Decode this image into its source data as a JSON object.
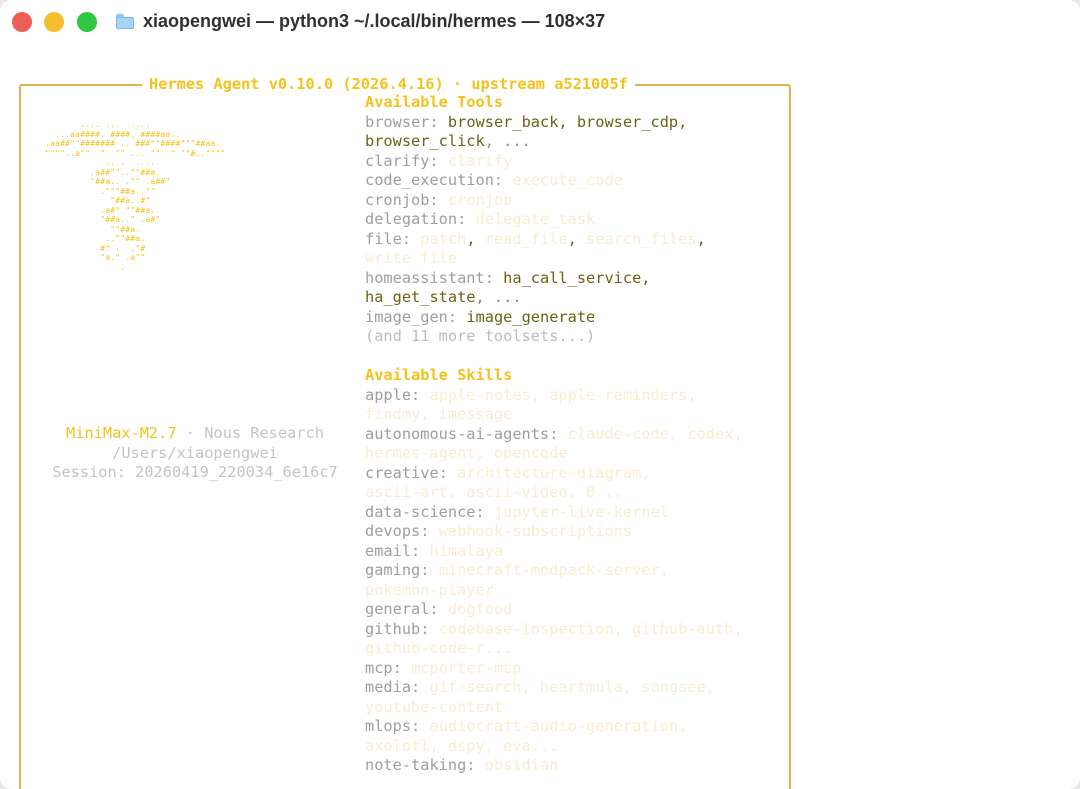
{
  "window": {
    "title": "xiaopengwei — python3 ~/.local/bin/hermes — 108×37",
    "controls": [
      "close",
      "minimize",
      "zoom"
    ]
  },
  "banner": {
    "title": "Hermes Agent v0.10.0 (2026.4.16) · upstream a521005f"
  },
  "logo_art": "        .... ...  ....\n    ..aa####. ####. ####aa..\n .aa##\"\"####### .. ###\"\"####\"\"\"##aa.\n \"\"\"\"..a\"\"  \"  \"\" ... \"\"  \" \"\"#..\"\"\"\"\n             ....  ....\n          .a##\"\"..\"\"##a.\n          \"##a.. .\"\" .a##\"\n            .\"\"\"##a..\"\"\n              \"##a..#\"\n            .a#\" \"\"##a.\n            \"##a..\" .a#\"\n              \"\"##a.\n             ..\"\"##a.\n            #\" .  .\"#\n            \"a.\" .a\"\"\n                .",
  "info": {
    "model": "MiniMax-M2.7",
    "separator": " · ",
    "provider": "Nous Research",
    "cwd": "/Users/xiaopengwei",
    "session": "Session: 20260419_220034_6e16c7"
  },
  "tools": {
    "heading": "Available Tools",
    "browser_label": "browser:",
    "browser_items_1": "browser_back, browser_cdp,",
    "browser_items_2": "browser_click",
    "browser_more": ", ...",
    "clarify_label": "clarify:",
    "clarify_items": "clarify",
    "code_label": "code_execution:",
    "code_items": "execute_code",
    "cron_label": "cronjob:",
    "cron_items": "cronjob",
    "delegation_label": "delegation:",
    "delegation_items": "delegate_task",
    "file_label": "file:",
    "file_items_1": "patch",
    "file_sep_1": ", ",
    "file_items_2": "read_file",
    "file_sep_2": ", ",
    "file_items_3": "search_files",
    "file_sep_3": ",",
    "file_items_4": "write_file",
    "ha_label": "homeassistant:",
    "ha_items_1": "ha_call_service,",
    "ha_items_2": "ha_get_state",
    "ha_more": ", ...",
    "image_label": "image_gen:",
    "image_items": "image_generate",
    "more": "(and 11 more toolsets...)"
  },
  "skills": {
    "heading": "Available Skills",
    "apple_label": "apple:",
    "apple_items_1": "apple-notes, apple-reminders,",
    "apple_items_2": "findmy, imessage",
    "autonomous_label": "autonomous-ai-agents:",
    "autonomous_items_1": "claude-code, codex,",
    "autonomous_items_2": "hermes-agent, opencode",
    "creative_label": "creative:",
    "creative_items_1": "architecture-diagram,",
    "creative_items_2": "ascii-art, ascii-video, 0...",
    "datascience_label": "data-science:",
    "datascience_items": "jupyter-live-kernel",
    "devops_label": "devops:",
    "devops_items": "webhook-subscriptions",
    "email_label": "email:",
    "email_items": "himalaya",
    "gaming_label": "gaming:",
    "gaming_items_1": "minecraft-modpack-server,",
    "gaming_items_2": "pokemon-player",
    "general_label": "general:",
    "general_items": "dogfood",
    "github_label": "github:",
    "github_items_1": "codebase-inspection, github-auth,",
    "github_items_2": "github-code-r...",
    "mcp_label": "mcp:",
    "mcp_items": "mcporter-mcp",
    "media_label": "media:",
    "media_items_1": "gif-search, heartmula, songsee,",
    "media_items_2": "youtube-content",
    "mlops_label": "mlops:",
    "mlops_items_1": "audiocraft-audio-generation,",
    "mlops_items_2": "axolotl, dspy, eva...",
    "notetaking_label": "note-taking:",
    "notetaking_items": "obsidian"
  },
  "colors": {
    "accent_gold": "#f3c31c",
    "border": "#e3b24f",
    "tool_name": "#6d6212",
    "category": "#9e9e9e",
    "faint": "#f8edd0",
    "close": "#ec5f57",
    "minimize": "#f6be2f",
    "zoom": "#2fc840"
  }
}
